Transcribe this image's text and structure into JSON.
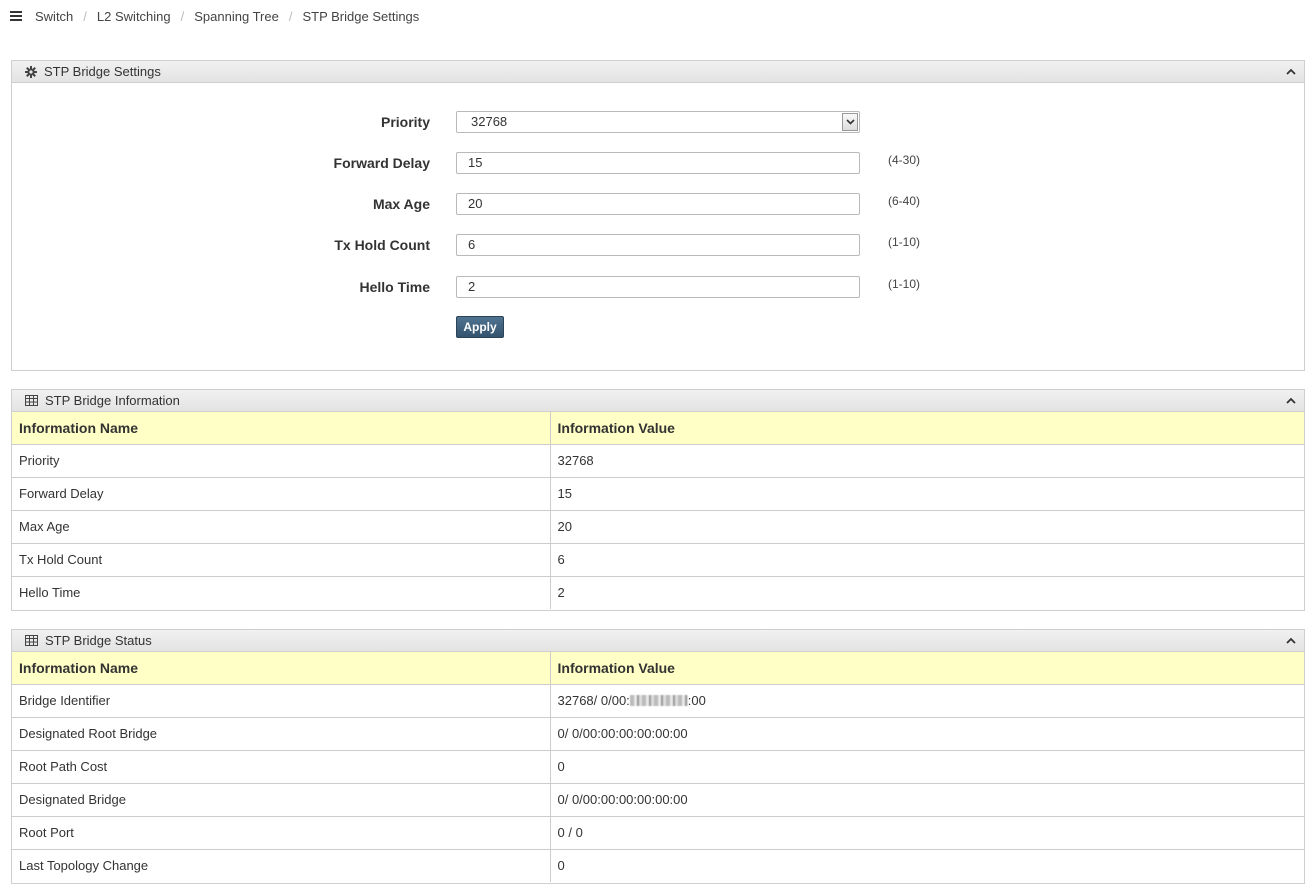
{
  "breadcrumb": {
    "items": [
      "Switch",
      "L2 Switching",
      "Spanning Tree",
      "STP Bridge Settings"
    ]
  },
  "settings_panel": {
    "title": "STP Bridge Settings",
    "priority": {
      "label": "Priority",
      "value": "32768"
    },
    "forward_delay": {
      "label": "Forward Delay",
      "value": "15",
      "range": "(4-30)"
    },
    "max_age": {
      "label": "Max Age",
      "value": "20",
      "range": "(6-40)"
    },
    "tx_hold_count": {
      "label": "Tx Hold Count",
      "value": "6",
      "range": "(1-10)"
    },
    "hello_time": {
      "label": "Hello Time",
      "value": "2",
      "range": "(1-10)"
    },
    "apply_label": "Apply"
  },
  "info_panel": {
    "title": "STP Bridge Information",
    "headers": [
      "Information Name",
      "Information Value"
    ],
    "rows": [
      [
        "Priority",
        "32768"
      ],
      [
        "Forward Delay",
        "15"
      ],
      [
        "Max Age",
        "20"
      ],
      [
        "Tx Hold Count",
        "6"
      ],
      [
        "Hello Time",
        "2"
      ]
    ]
  },
  "status_panel": {
    "title": "STP Bridge Status",
    "headers": [
      "Information Name",
      "Information Value"
    ],
    "rows": [
      [
        "Bridge Identifier",
        "32768/ 0/00:",
        ":00"
      ],
      [
        "Designated Root Bridge",
        "0/ 0/00:00:00:00:00:00"
      ],
      [
        "Root Path Cost",
        "0"
      ],
      [
        "Designated Bridge",
        "0/ 0/00:00:00:00:00:00"
      ],
      [
        "Root Port",
        "0 / 0"
      ],
      [
        "Last Topology Change",
        "0"
      ]
    ]
  },
  "colors": {
    "table_header_bg": "#ffffc6",
    "apply_button_bg": "#3e5f7b",
    "panel_header_bg": "#e8e8e8"
  },
  "icons": {
    "menu": "menu-icon",
    "settings": "gear-icon",
    "table": "table-icon",
    "collapse": "chevron-up-icon",
    "select": "chevron-down-icon"
  }
}
